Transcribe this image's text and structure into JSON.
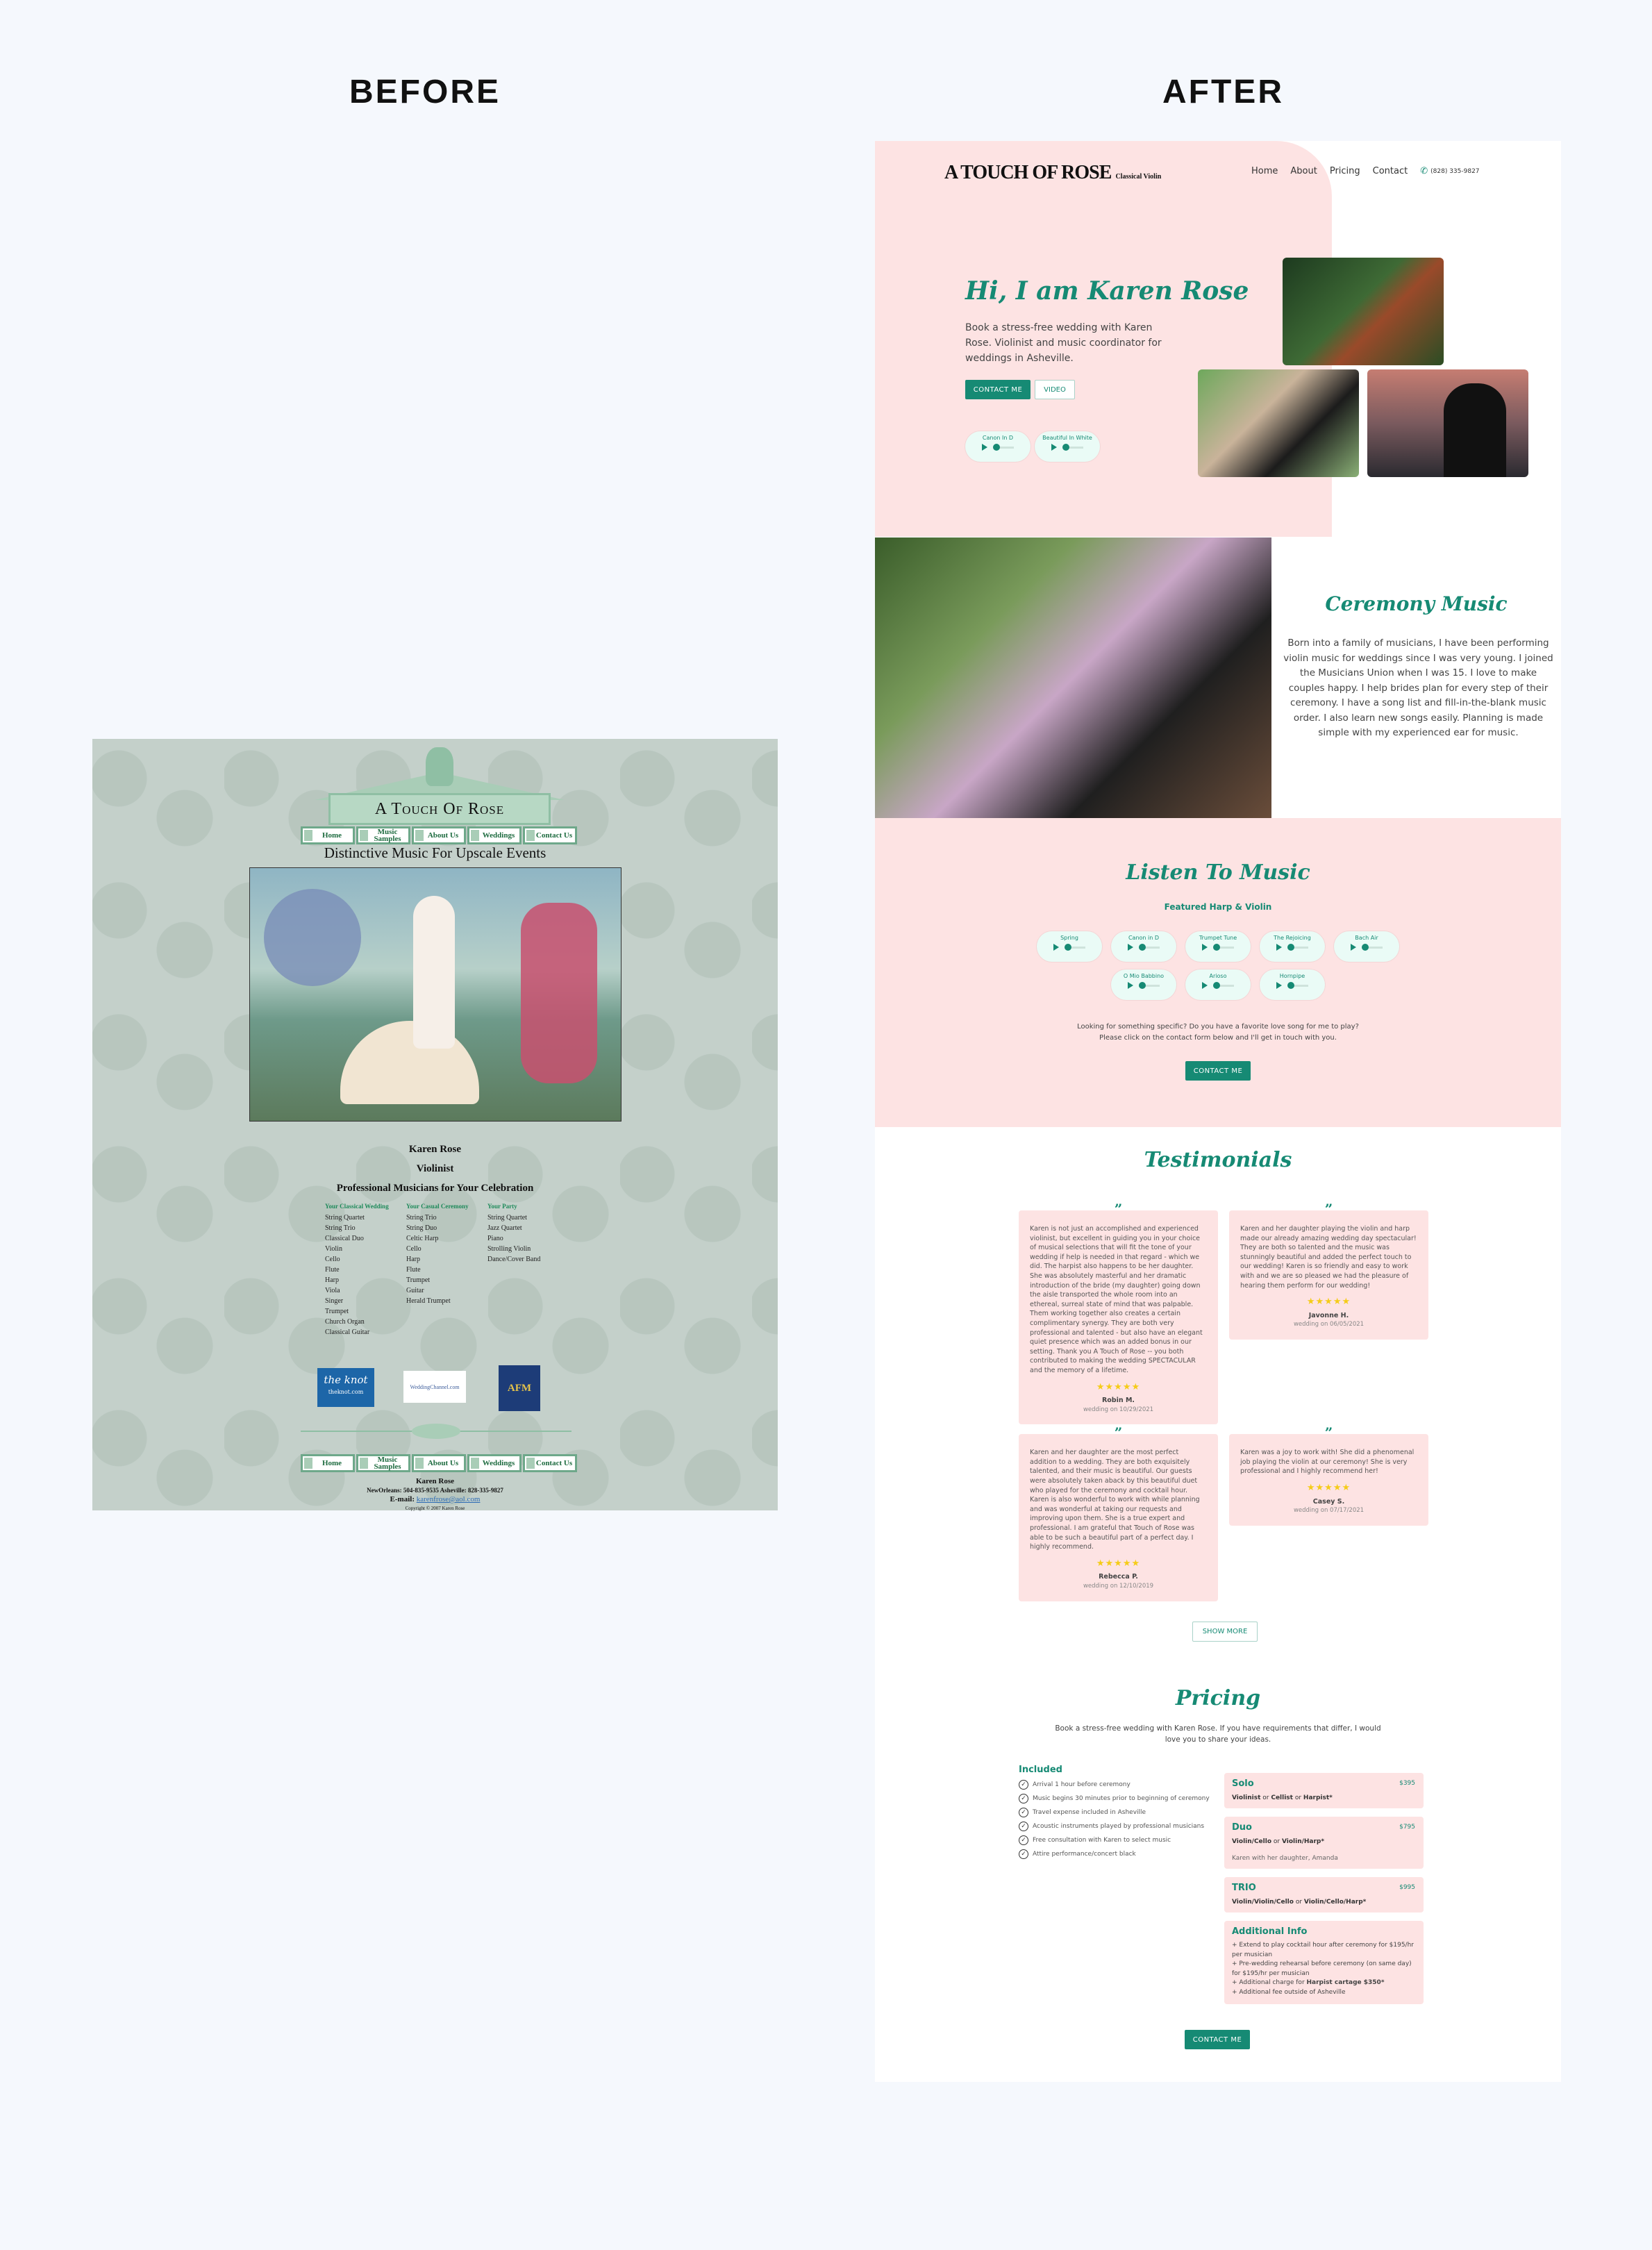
{
  "labels": {
    "before": "BEFORE",
    "after": "AFTER"
  },
  "before": {
    "logo_text": "A Touch Of Rose",
    "nav": [
      "Home",
      "Music Samples",
      "About Us",
      "Weddings",
      "Contact Us"
    ],
    "tagline": "Distinctive Music For Upscale Events",
    "name": "Karen Rose",
    "role": "Violinist",
    "headline": "Professional Musicians for Your Celebration",
    "columns": [
      {
        "title": "Your Classical Wedding",
        "items": [
          "String Quartet",
          "String Trio",
          "Classical Duo",
          "Violin",
          "Cello",
          "Flute",
          "Harp",
          "Viola",
          "Singer",
          "Trumpet",
          "Church Organ",
          "Classical Guitar"
        ]
      },
      {
        "title": "Your Casual Ceremony",
        "items": [
          "String Trio",
          "String Duo",
          "Celtic Harp",
          "Cello",
          "Harp",
          "Flute",
          "Trumpet",
          "Guitar",
          "Herald Trumpet"
        ]
      },
      {
        "title": "Your Party",
        "items": [
          "String Quartet",
          "Jazz Quartet",
          "Piano",
          "Strolling Violin",
          "Dance/Cover Band"
        ]
      }
    ],
    "logos": {
      "knot": "the knot",
      "knot_url": "theknot.com",
      "wedding_channel": "WeddingChannel.com",
      "afm": "AFM"
    },
    "footer": {
      "name": "Karen Rose",
      "phones": "NewOrleans: 504-835-9535    Asheville: 828-335-9827",
      "email_label": "E-mail:",
      "email": "karenfrose@aol.com",
      "copyright": "Copyright © 2007 Karen Rose"
    }
  },
  "after": {
    "logo": "A TOUCH OF ROSE",
    "logo_sub": "Classical Violin",
    "nav": [
      "Home",
      "About",
      "Pricing",
      "Contact"
    ],
    "phone": "(828) 335-9827",
    "hero": {
      "title": "Hi, I am Karen Rose",
      "text": "Book a stress-free wedding with Karen Rose. Violinist and music coordinator for weddings in Asheville.",
      "contact_btn": "CONTACT ME",
      "video_btn": "VIDEO",
      "players": [
        "Canon In D",
        "Beautiful In White"
      ]
    },
    "ceremony": {
      "title": "Ceremony Music",
      "text": "Born into a family of musicians, I have been performing violin music for weddings since I was very young. I joined the Musicians Union when I was 15. I love to make couples happy. I help brides plan for every step of their ceremony. I have a song list and fill-in-the-blank music order. I also learn new songs easily. Planning is made simple with my experienced ear for music."
    },
    "listen": {
      "title": "Listen To Music",
      "subtitle": "Featured Harp & Violin",
      "tracks": [
        "Spring",
        "Canon in D",
        "Trumpet Tune",
        "The Rejoicing",
        "Bach Air",
        "O Mio Babbino",
        "Arioso",
        "Hornpipe"
      ],
      "note_line1": "Looking for something specific? Do you have a favorite love song for me to play?",
      "note_line2": "Please click on the contact form below and I'll get in touch with you.",
      "contact_btn": "CONTACT ME"
    },
    "testimonials": {
      "title": "Testimonials",
      "items": [
        {
          "text": "Karen is not just an accomplished and experienced violinist, but excellent in guiding you in your choice of musical selections that will fit the tone of your wedding if help is needed in that regard - which we did. The harpist also happens to be her daughter. She was absolutely masterful and her dramatic introduction of the bride (my daughter) going down the aisle transported the whole room into an ethereal, surreal state of mind that was palpable. Them working together also creates a certain complimentary synergy. They are both very professional and talented - but also have an elegant quiet presence which was an added bonus in our setting. Thank you A Touch of Rose -- you both contributed to making the wedding SPECTACULAR and the memory of a lifetime.",
          "rating": 5,
          "stars": "★★★★★",
          "author": "Robin M.",
          "date": "wedding on 10/29/2021"
        },
        {
          "text": "Karen and her daughter playing the violin and harp made our already amazing wedding day spectacular! They are both so talented and the music was stunningly beautiful and added the perfect touch to our wedding! Karen is so friendly and easy to work with and we are so pleased we had the pleasure of hearing them perform for our wedding!",
          "rating": 5,
          "stars": "★★★★★",
          "author": "Javonne H.",
          "date": "wedding on 06/05/2021"
        },
        {
          "text": "Karen and her daughter are the most perfect addition to a wedding. They are both exquisitely talented, and their music is beautiful. Our guests were absolutely taken aback by this beautiful duet who played for the ceremony and cocktail hour. Karen is also wonderful to work with while planning and was wonderful at taking our requests and improving upon them. She is a true expert and professional. I am grateful that Touch of Rose was able to be such a beautiful part of a perfect day. I highly recommend.",
          "rating": 5,
          "stars": "★★★★★",
          "author": "Rebecca P.",
          "date": "wedding on 12/10/2019"
        },
        {
          "text": "Karen was a joy to work with! She did a phenomenal job playing the violin at our ceremony! She is very professional and I highly recommend her!",
          "rating": 5,
          "stars": "★★★★★",
          "author": "Casey S.",
          "date": "wedding on 07/17/2021"
        }
      ],
      "show_more": "SHOW MORE"
    },
    "pricing": {
      "title": "Pricing",
      "subtitle": "Book a stress-free wedding with Karen Rose. If you have requirements that differ, I would love you to share your ideas.",
      "included_title": "Included",
      "included": [
        "Arrival 1 hour before ceremony",
        "Music begins 30 minutes prior to beginning of ceremony",
        "Travel expense included in Asheville",
        "Acoustic instruments played by professional musicians",
        "Free consultation with Karen to select music",
        "Attire performance/concert black"
      ],
      "plans": [
        {
          "name": "Solo",
          "price": "$395",
          "opt1": "Violinist",
          "opt2": "Cellist",
          "opt3": "Harpist*",
          "note": ""
        },
        {
          "name": "Duo",
          "price": "$795",
          "opt1": "Violin/Cello",
          "opt2": "Violin/Harp*",
          "note": "Karen with her daughter, Amanda"
        },
        {
          "name": "TRIO",
          "price": "$995",
          "opt1": "Violin/Violin/Cello",
          "opt2": "Violin/Cello/Harp*",
          "note": ""
        }
      ],
      "or": "or",
      "additional_title": "Additional Info",
      "additional": [
        "+ Extend to play cocktail hour after ceremony for $195/hr per musician",
        "+ Pre-wedding rehearsal before ceremony (on same day) for $195/hr per musician",
        "+ Additional fee outside of Asheville"
      ],
      "cartage_prefix": "+ Additional charge for ",
      "cartage_bold": "Harpist cartage $350*",
      "contact_btn": "CONTACT ME"
    }
  }
}
